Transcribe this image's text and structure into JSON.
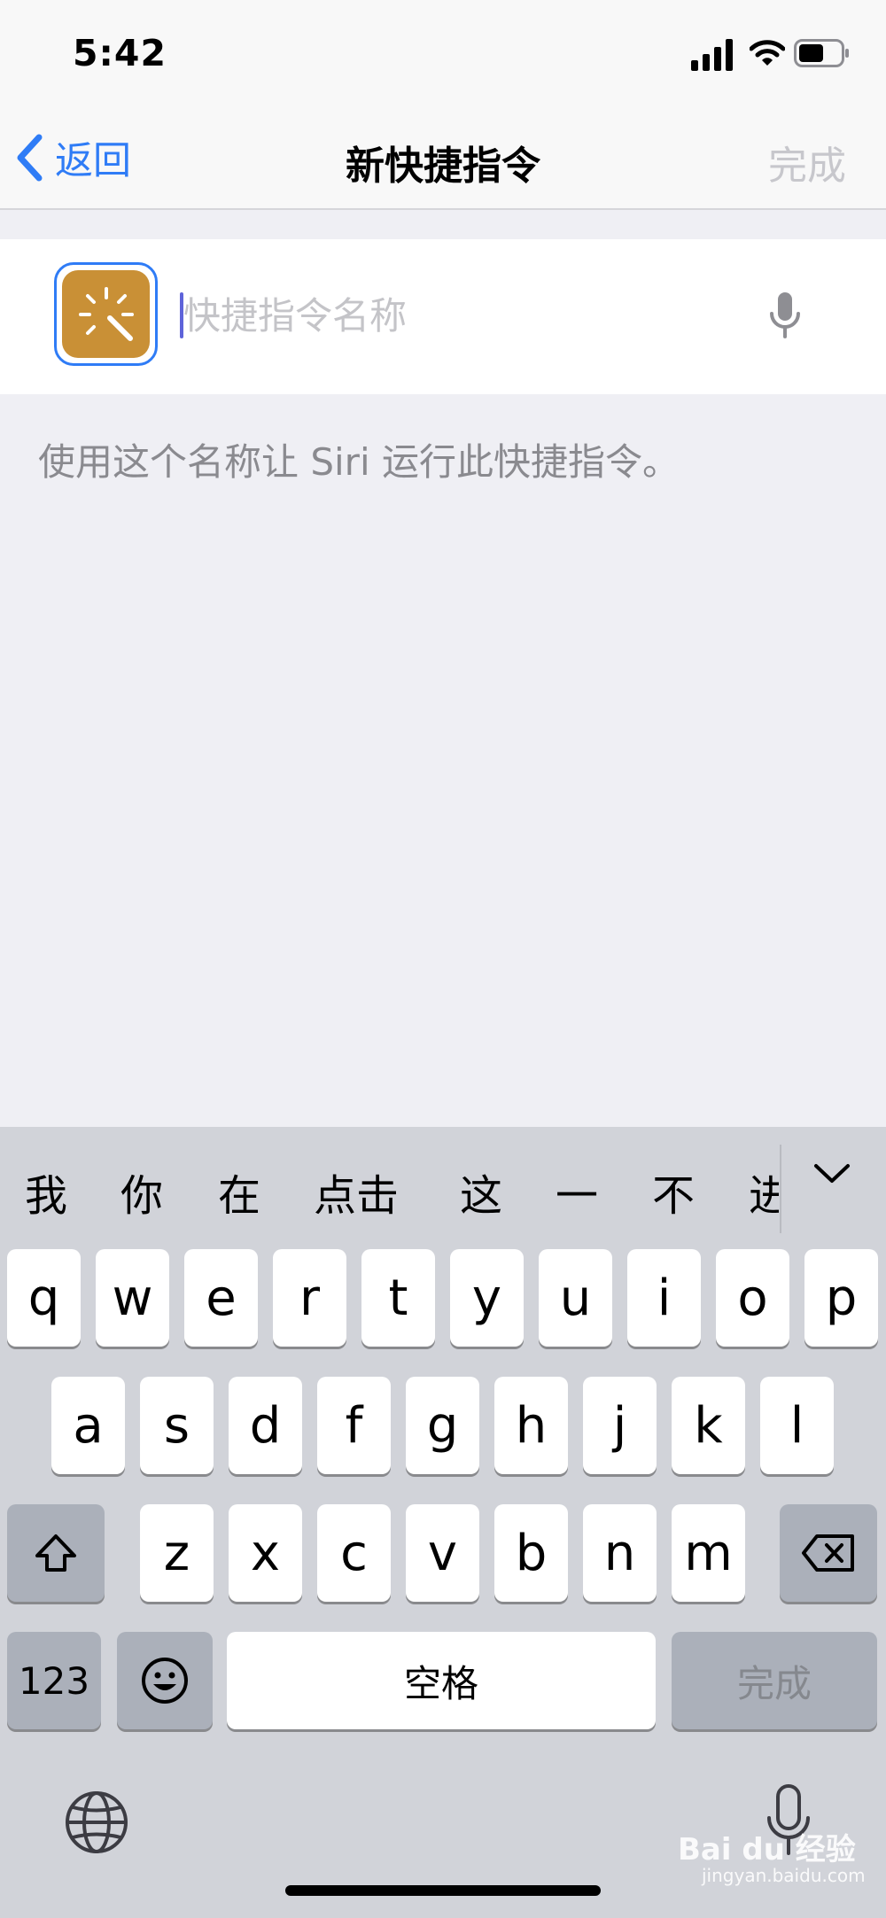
{
  "status": {
    "time": "5:42"
  },
  "nav": {
    "back_label": "返回",
    "title": "新快捷指令",
    "done_label": "完成"
  },
  "name_field": {
    "placeholder": "快捷指令名称",
    "value": ""
  },
  "hint": "使用这个名称让 Siri 运行此快捷指令。",
  "icon": {
    "name": "magic-wand-icon",
    "tile_color": "#C99036"
  },
  "keyboard": {
    "candidates": [
      "我",
      "你",
      "在",
      "点击",
      "这",
      "一",
      "不",
      "进"
    ],
    "row1": [
      "q",
      "w",
      "e",
      "r",
      "t",
      "y",
      "u",
      "i",
      "o",
      "p"
    ],
    "row2": [
      "a",
      "s",
      "d",
      "f",
      "g",
      "h",
      "j",
      "k",
      "l"
    ],
    "row3": [
      "z",
      "x",
      "c",
      "v",
      "b",
      "n",
      "m"
    ],
    "numbers_label": "123",
    "space_label": "空格",
    "done_label": "完成"
  },
  "watermark": {
    "brand": "Bai du 经验",
    "url": "jingyan.baidu.com"
  },
  "colors": {
    "accent": "#2F7CF6",
    "background": "#EFEFF4",
    "keyboard": "#D1D3D9"
  }
}
